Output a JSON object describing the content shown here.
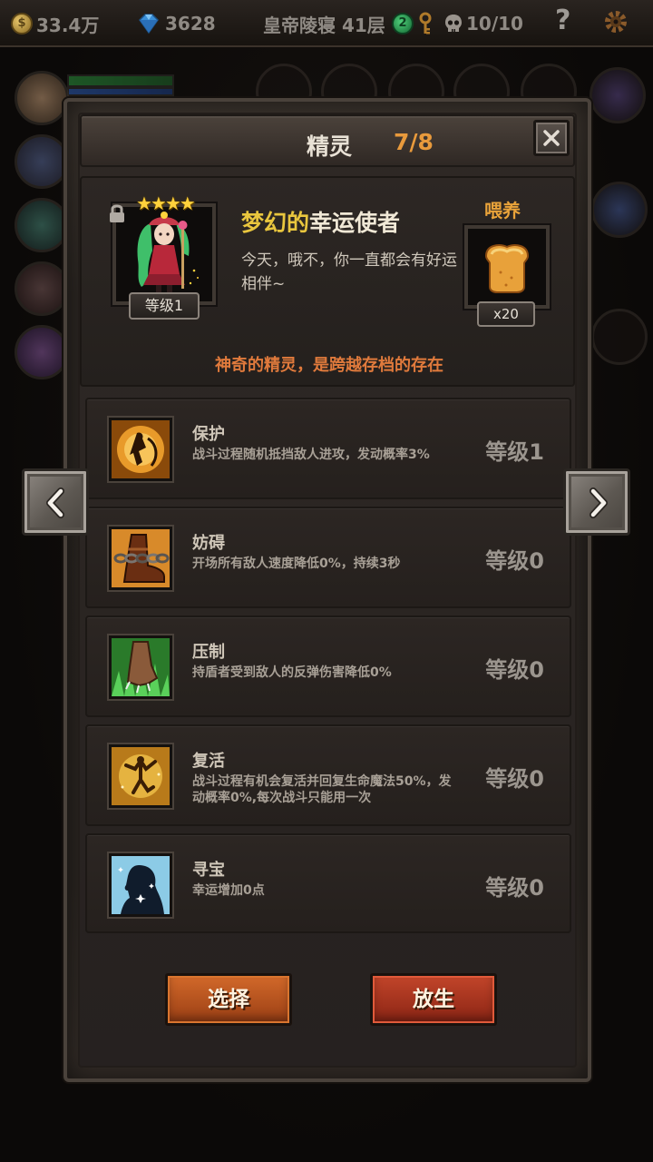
{
  "topbar": {
    "gold": "33.4万",
    "gems": "3628",
    "floor": "皇帝陵寝 41层",
    "green_count": "2",
    "skull": "10/10",
    "help": "?"
  },
  "dialog": {
    "title": "精灵",
    "count": "7/8",
    "close_icon": "close-icon"
  },
  "spirit": {
    "stars": "★★★★",
    "level": "等级1",
    "name_quality": "梦幻的",
    "name": "幸运使者",
    "description": "今天，哦不，你一直都会有好运相伴~",
    "feed_label": "喂养",
    "feed_count": "x20",
    "tagline": "神奇的精灵，是跨越存档的存在"
  },
  "skills": [
    {
      "name": "保护",
      "desc": "战斗过程随机抵挡敌人进攻，发动概率3%",
      "level": "等级1",
      "icon": "shield-dancer-icon"
    },
    {
      "name": "妨碍",
      "desc": "开场所有敌人速度降低0%，持续3秒",
      "level": "等级0",
      "icon": "chained-boot-icon"
    },
    {
      "name": "压制",
      "desc": "持盾者受到敌人的反弹伤害降低0%",
      "level": "等级0",
      "icon": "beast-claw-icon"
    },
    {
      "name": "复活",
      "desc": "战斗过程有机会复活并回复生命魔法50%，发动概率0%,每次战斗只能用一次",
      "level": "等级0",
      "icon": "revive-dancer-icon"
    },
    {
      "name": "寻宝",
      "desc": "幸运增加0点",
      "level": "等级0",
      "icon": "treasure-silhouette-icon"
    }
  ],
  "buttons": {
    "select": "选择",
    "release": "放生"
  },
  "colors": {
    "accent_orange": "#e89a3c",
    "quality_gold": "#e9c63e",
    "tagline": "#e07a3c",
    "button_select": "#d2692a",
    "button_release": "#c2452a"
  }
}
